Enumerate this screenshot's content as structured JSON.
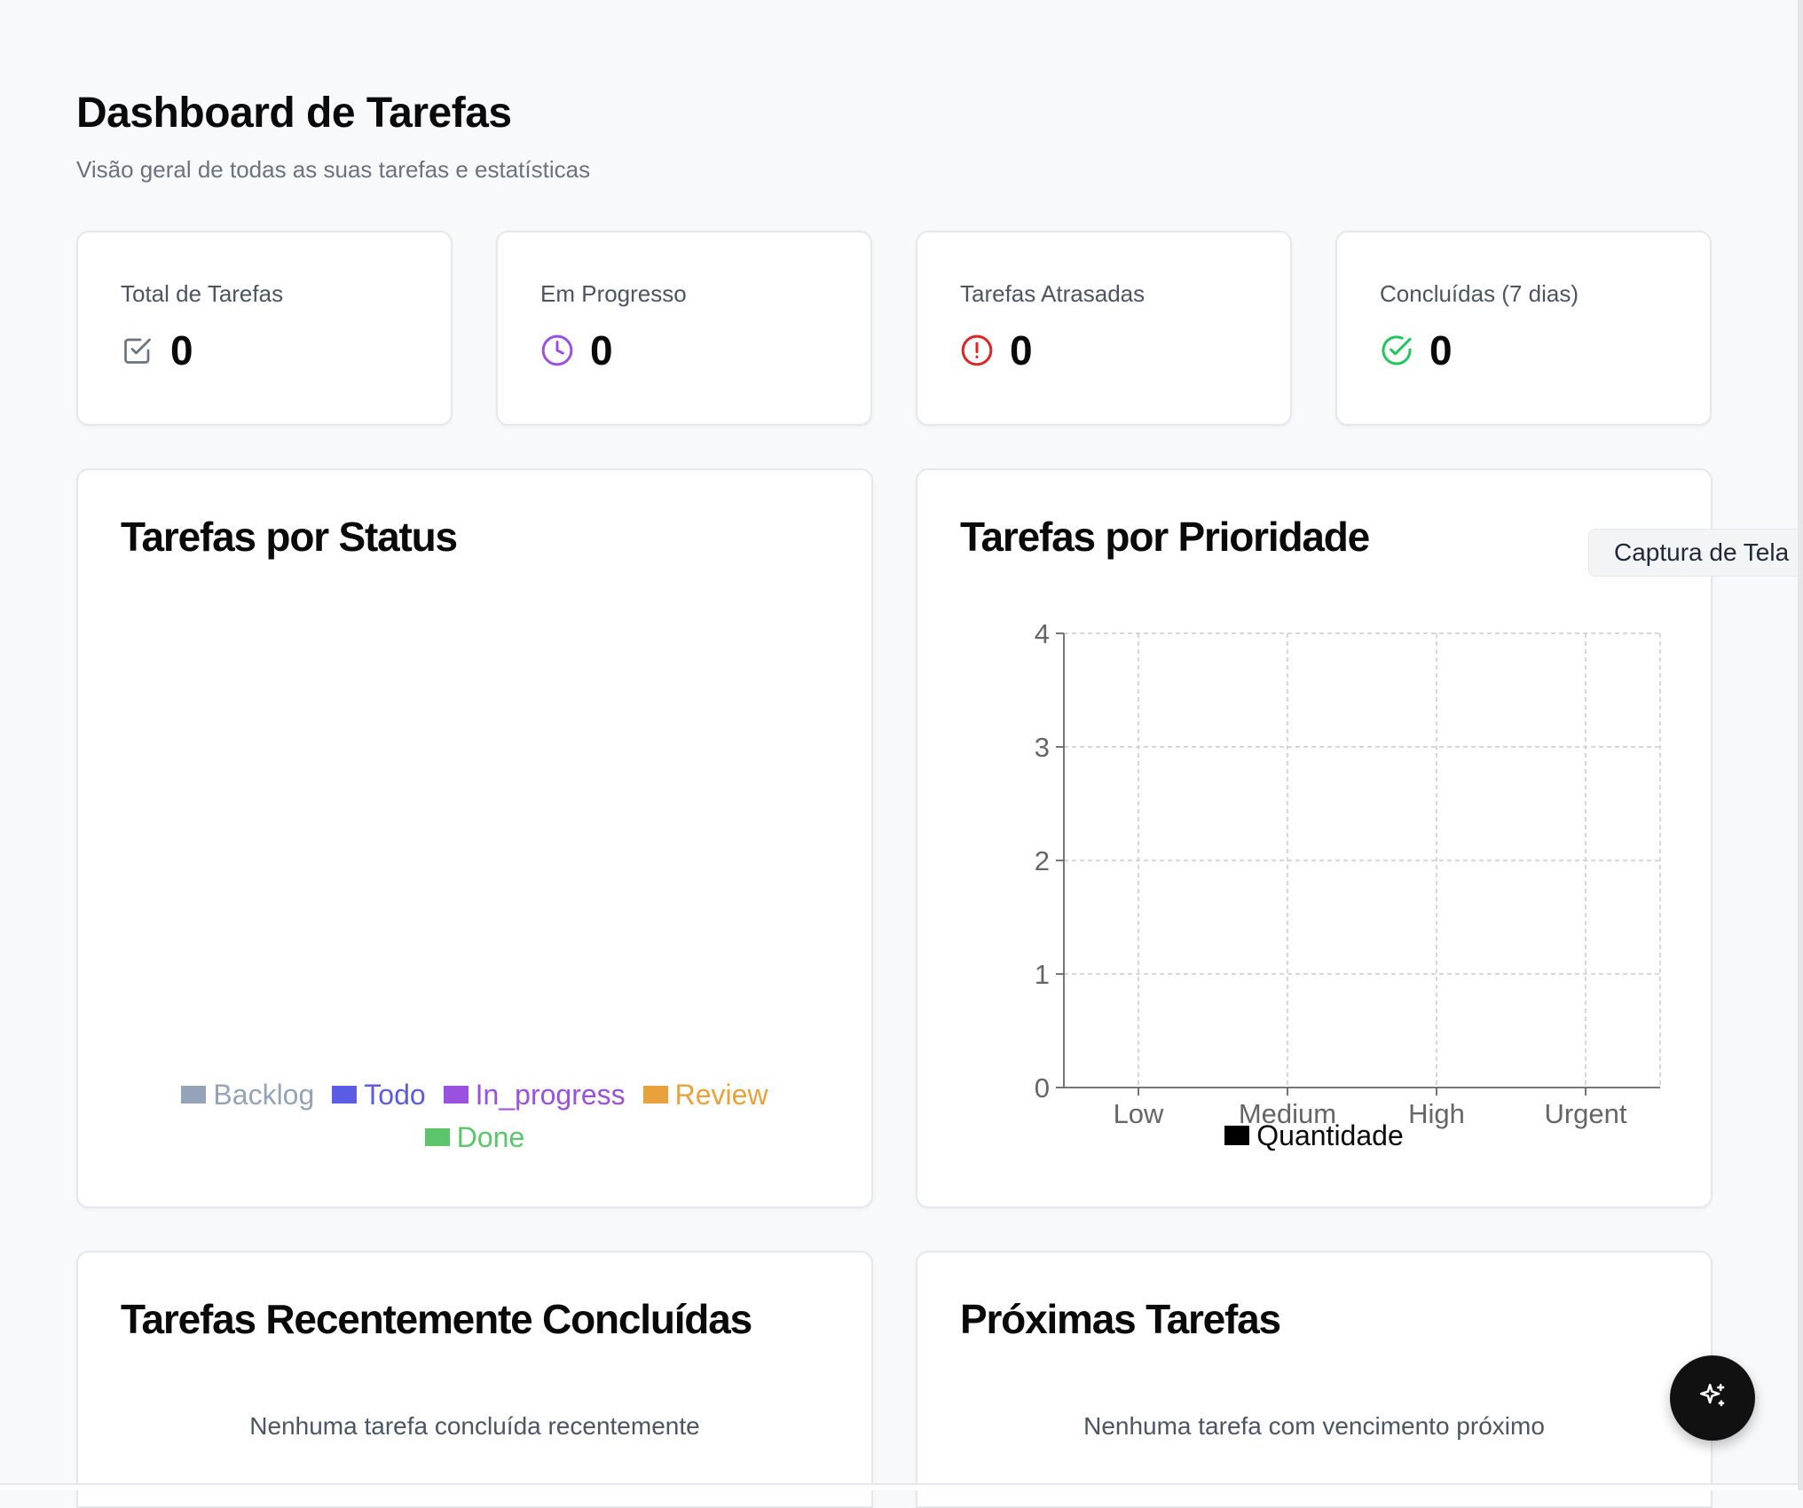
{
  "header": {
    "title": "Dashboard de Tarefas",
    "subtitle": "Visão geral de todas as suas tarefas e estatísticas"
  },
  "stats": [
    {
      "label": "Total de Tarefas",
      "value": "0",
      "icon": "checkbox-icon",
      "color": "#6b7280"
    },
    {
      "label": "Em Progresso",
      "value": "0",
      "icon": "clock-icon",
      "color": "#9b51e0"
    },
    {
      "label": "Tarefas Atrasadas",
      "value": "0",
      "icon": "alert-circle-icon",
      "color": "#dc2626"
    },
    {
      "label": "Concluídas (7 dias)",
      "value": "0",
      "icon": "check-circle-icon",
      "color": "#22c55e"
    }
  ],
  "status_chart": {
    "title": "Tarefas por Status",
    "legend": [
      {
        "label": "Backlog",
        "color": "#94a3b8"
      },
      {
        "label": "Todo",
        "color": "#5b5ce6"
      },
      {
        "label": "In_progress",
        "color": "#9b51e0"
      },
      {
        "label": "Review",
        "color": "#e9a23b"
      },
      {
        "label": "Done",
        "color": "#5cc56b"
      }
    ]
  },
  "priority_chart": {
    "title": "Tarefas por Prioridade",
    "legend_label": "Quantidade",
    "legend_color": "#000000"
  },
  "recent": {
    "title": "Tarefas Recentemente Concluídas",
    "empty": "Nenhuma tarefa concluída recentemente"
  },
  "upcoming": {
    "title": "Próximas Tarefas",
    "empty": "Nenhuma tarefa com vencimento próximo"
  },
  "tooltip": {
    "text": "Captura de Tela"
  },
  "fab": {
    "icon": "sparkle-icon"
  },
  "chart_data": [
    {
      "type": "pie",
      "title": "Tarefas por Status",
      "categories": [
        "Backlog",
        "Todo",
        "In_progress",
        "Review",
        "Done"
      ],
      "values": [
        0,
        0,
        0,
        0,
        0
      ],
      "legend": "bottom"
    },
    {
      "type": "bar",
      "title": "Tarefas por Prioridade",
      "categories": [
        "Low",
        "Medium",
        "High",
        "Urgent"
      ],
      "series": [
        {
          "name": "Quantidade",
          "values": [
            0,
            0,
            0,
            0
          ]
        }
      ],
      "yticks": [
        "0",
        "1",
        "2",
        "3",
        "4"
      ],
      "ylim": [
        0,
        4
      ],
      "grid": true,
      "legend": "bottom"
    }
  ]
}
